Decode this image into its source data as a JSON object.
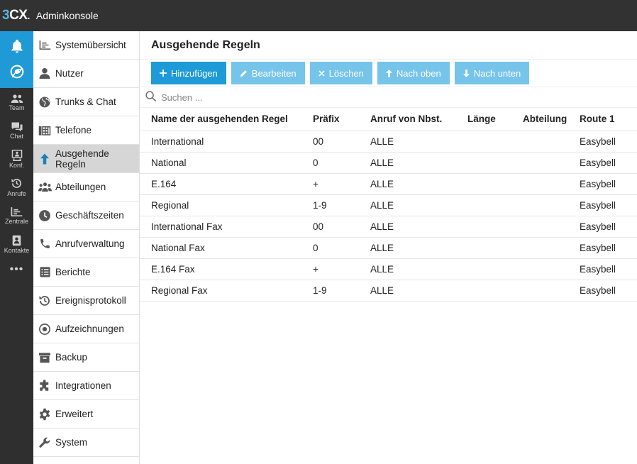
{
  "app": {
    "logo_primary": "3",
    "logo_secondary": "CX",
    "title": "Adminkonsole",
    "accent": "#1e9ad6",
    "accent_light": "#76c4ea"
  },
  "rail": {
    "top_icons": [
      "bell-icon",
      "chrome-icon"
    ],
    "items": [
      {
        "label": "Team",
        "icon": "team-icon"
      },
      {
        "label": "Chat",
        "icon": "chat-icon"
      },
      {
        "label": "Konf.",
        "icon": "conference-icon"
      },
      {
        "label": "Anrufe",
        "icon": "history-icon"
      },
      {
        "label": "Zentrale",
        "icon": "switchboard-icon"
      },
      {
        "label": "Kontakte",
        "icon": "contacts-icon"
      }
    ],
    "more": "•••"
  },
  "menu": {
    "items": [
      {
        "label": "Systemübersicht",
        "icon": "dashboard-icon"
      },
      {
        "label": "Nutzer",
        "icon": "user-icon"
      },
      {
        "label": "Trunks & Chat",
        "icon": "globe-icon"
      },
      {
        "label": "Telefone",
        "icon": "phone-grid-icon"
      },
      {
        "label": "Ausgehende Regeln",
        "icon": "arrow-up-icon",
        "active": true
      },
      {
        "label": "Abteilungen",
        "icon": "group-icon"
      },
      {
        "label": "Geschäftszeiten",
        "icon": "clock-icon"
      },
      {
        "label": "Anrufverwaltung",
        "icon": "phone-icon"
      },
      {
        "label": "Berichte",
        "icon": "report-icon"
      },
      {
        "label": "Ereignisprotokoll",
        "icon": "history-icon"
      },
      {
        "label": "Aufzeichnungen",
        "icon": "record-icon"
      },
      {
        "label": "Backup",
        "icon": "archive-icon"
      },
      {
        "label": "Integrationen",
        "icon": "puzzle-icon"
      },
      {
        "label": "Erweitert",
        "icon": "gear-icon"
      },
      {
        "label": "System",
        "icon": "wrench-icon"
      }
    ]
  },
  "page": {
    "title": "Ausgehende Regeln"
  },
  "toolbar": {
    "add": "Hinzufügen",
    "edit": "Bearbeiten",
    "delete": "Löschen",
    "up": "Nach oben",
    "down": "Nach unten"
  },
  "search": {
    "placeholder": "Suchen ..."
  },
  "table": {
    "columns": [
      "Name der ausgehenden Regel",
      "Präfix",
      "Anruf von Nbst.",
      "Länge",
      "Abteilung",
      "Route 1"
    ],
    "rows": [
      [
        "International",
        "00",
        "ALLE",
        "",
        "",
        "Easybell"
      ],
      [
        "National",
        "0",
        "ALLE",
        "",
        "",
        "Easybell"
      ],
      [
        "E.164",
        "+",
        "ALLE",
        "",
        "",
        "Easybell"
      ],
      [
        "Regional",
        "1-9",
        "ALLE",
        "",
        "",
        "Easybell"
      ],
      [
        "International Fax",
        "00",
        "ALLE",
        "",
        "",
        "Easybell"
      ],
      [
        "National Fax",
        "0",
        "ALLE",
        "",
        "",
        "Easybell"
      ],
      [
        "E.164 Fax",
        "+",
        "ALLE",
        "",
        "",
        "Easybell"
      ],
      [
        "Regional Fax",
        "1-9",
        "ALLE",
        "",
        "",
        "Easybell"
      ]
    ]
  }
}
